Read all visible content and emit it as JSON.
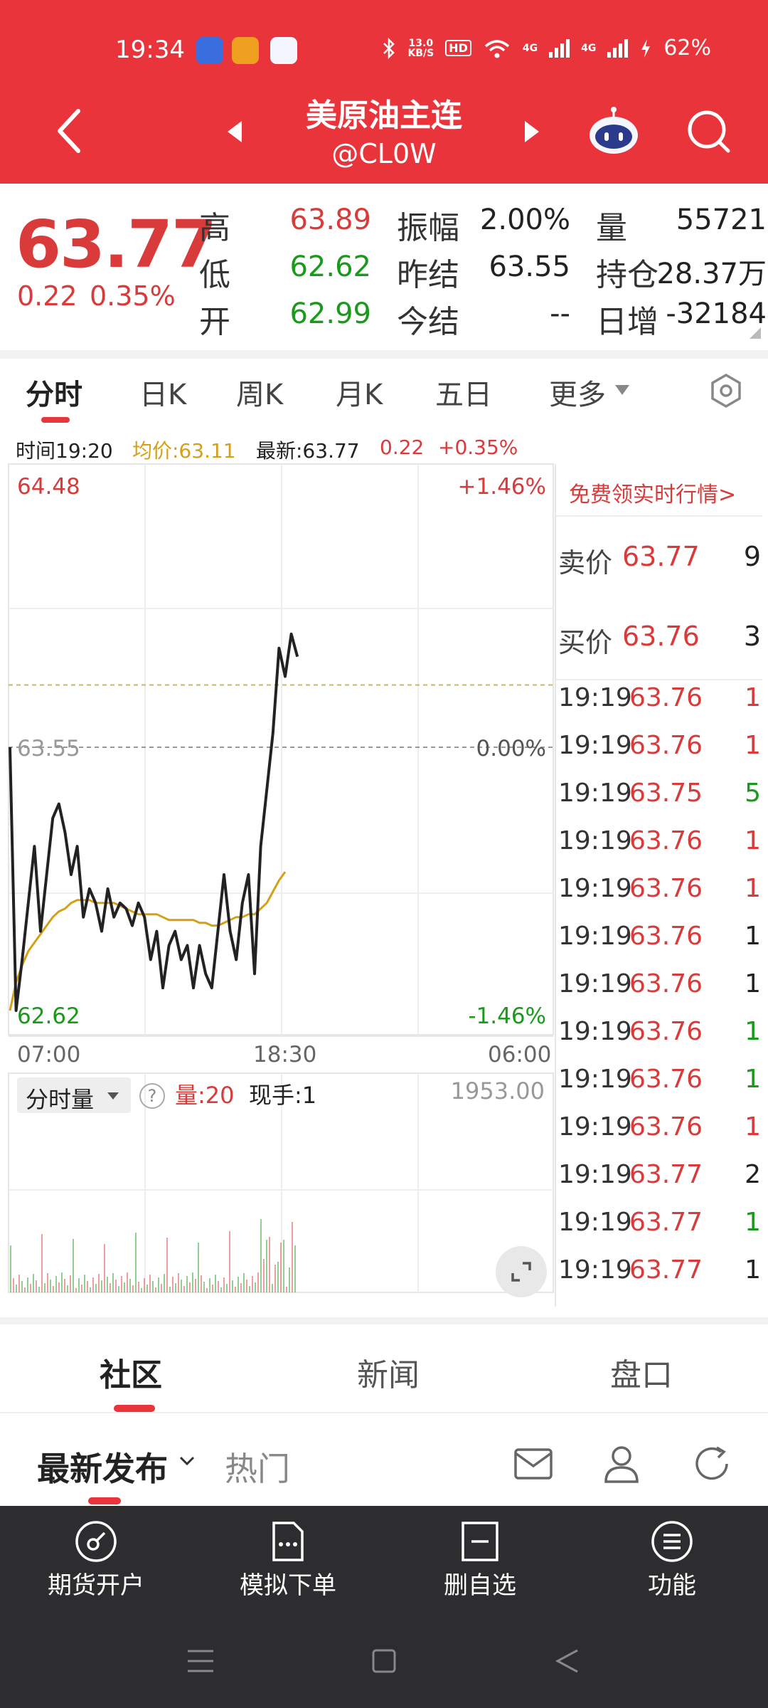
{
  "status_bar": {
    "time": "19:34",
    "speed_value": "13.0",
    "speed_unit": "KB/S",
    "hd": "HD",
    "network1": "4G",
    "network2": "4G",
    "battery": "62%"
  },
  "header": {
    "title": "美原油主连",
    "code": "@CL0W"
  },
  "quote": {
    "price": "63.77",
    "change": "0.22",
    "change_pct": "0.35%",
    "stats": [
      {
        "label": "高",
        "value": "63.89"
      },
      {
        "label": "低",
        "value": "62.62"
      },
      {
        "label": "开",
        "value": "62.99"
      },
      {
        "label": "振幅",
        "value": "2.00%"
      },
      {
        "label": "昨结",
        "value": "63.55"
      },
      {
        "label": "今结",
        "value": "--"
      },
      {
        "label": "量",
        "value": "55721"
      },
      {
        "label": "持仓",
        "value": "28.37万"
      },
      {
        "label": "日增",
        "value": "-32184"
      }
    ]
  },
  "tabs": [
    "分时",
    "日K",
    "周K",
    "月K",
    "五日",
    "更多"
  ],
  "info_row": {
    "time": "时间19:20",
    "avg": "均价:63.11",
    "latest": "最新:63.77",
    "change": "0.22",
    "change_pct": "+0.35%"
  },
  "chart": {
    "y_top": "64.48",
    "y_mid": "63.55",
    "y_bottom": "62.62",
    "pct_top": "+1.46%",
    "pct_mid": "0.00%",
    "pct_bottom": "-1.46%",
    "x_labels": [
      "07:00",
      "18:30",
      "06:00"
    ],
    "colors": {
      "price": "#222222",
      "avg": "#d4a017",
      "up": "#e05050",
      "down": "#38a838"
    }
  },
  "chart_data": {
    "type": "line",
    "ylim": [
      62.62,
      64.48
    ],
    "reference": 63.55,
    "series": [
      {
        "values": [
          63.55,
          62.62,
          62.8,
          63.0,
          63.2,
          62.9,
          63.1,
          63.3,
          63.35,
          63.25,
          63.1,
          63.2,
          62.95,
          63.05,
          63.0,
          62.9,
          63.05,
          62.95,
          63.0,
          62.98,
          62.92,
          63.0,
          62.95,
          62.8,
          62.9,
          62.7,
          62.85,
          62.9,
          62.8,
          62.85,
          62.7,
          62.85,
          62.75,
          62.7,
          62.9,
          63.1,
          62.9,
          62.8,
          63.0,
          63.1,
          62.75,
          63.2,
          63.4,
          63.6,
          63.9,
          63.8,
          63.95,
          63.87
        ]
      },
      {
        "values": [
          62.62,
          62.72,
          62.78,
          62.83,
          62.86,
          62.89,
          62.92,
          62.95,
          62.97,
          62.98,
          63.0,
          63.01,
          63.01,
          63.01,
          63.0,
          63.0,
          63.0,
          63.0,
          62.99,
          62.98,
          62.97,
          62.96,
          62.96,
          62.96,
          62.96,
          62.95,
          62.94,
          62.94,
          62.94,
          62.94,
          62.94,
          62.93,
          62.93,
          62.92,
          62.92,
          62.93,
          62.94,
          62.95,
          62.95,
          62.96,
          62.96,
          62.98,
          63.0,
          63.04,
          63.08,
          63.11
        ]
      }
    ]
  },
  "right_panel": {
    "promo": "免费领实时行情>",
    "ask": {
      "label": "卖价",
      "price": "63.77",
      "qty": "9"
    },
    "bid": {
      "label": "买价",
      "price": "63.76",
      "qty": "3"
    },
    "trades": [
      {
        "time": "19:19",
        "price": "63.76",
        "qty": "1",
        "color": "red"
      },
      {
        "time": "19:19",
        "price": "63.76",
        "qty": "1",
        "color": "red"
      },
      {
        "time": "19:19",
        "price": "63.75",
        "qty": "5",
        "color": "green"
      },
      {
        "time": "19:19",
        "price": "63.76",
        "qty": "1",
        "color": "red"
      },
      {
        "time": "19:19",
        "price": "63.76",
        "qty": "1",
        "color": "red"
      },
      {
        "time": "19:19",
        "price": "63.76",
        "qty": "1",
        "color": "dark"
      },
      {
        "time": "19:19",
        "price": "63.76",
        "qty": "1",
        "color": "dark"
      },
      {
        "time": "19:19",
        "price": "63.76",
        "qty": "1",
        "color": "green"
      },
      {
        "time": "19:19",
        "price": "63.76",
        "qty": "1",
        "color": "green"
      },
      {
        "time": "19:19",
        "price": "63.76",
        "qty": "1",
        "color": "red"
      },
      {
        "time": "19:19",
        "price": "63.77",
        "qty": "2",
        "color": "dark"
      },
      {
        "time": "19:19",
        "price": "63.77",
        "qty": "1",
        "color": "green"
      },
      {
        "time": "19:19",
        "price": "63.77",
        "qty": "1",
        "color": "dark"
      }
    ]
  },
  "volume": {
    "dropdown": "分时量",
    "help": "?",
    "vol_label": "量:20",
    "hand_label": "现手:1",
    "max": "1953.00"
  },
  "lower_tabs": [
    "社区",
    "新闻",
    "盘口"
  ],
  "sub_tabs": {
    "latest": "最新发布",
    "hot": "热门"
  },
  "bottom_bar": [
    {
      "label": "期货开户",
      "icon": "compass-icon"
    },
    {
      "label": "模拟下单",
      "icon": "document-icon"
    },
    {
      "label": "删自选",
      "icon": "minus-box-icon"
    },
    {
      "label": "功能",
      "icon": "menu-circle-icon"
    }
  ]
}
